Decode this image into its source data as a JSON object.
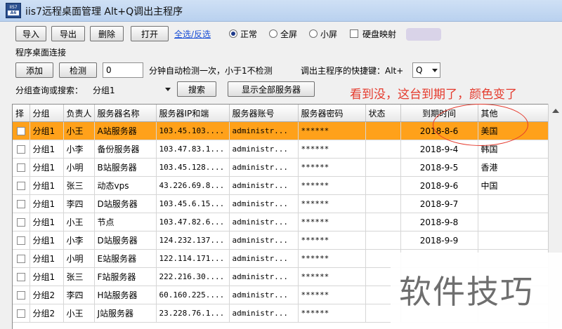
{
  "window": {
    "title": "iis7远程桌面管理 Alt+Q调出主程序",
    "icon_label_top": "IIS7",
    "icon_label_bottom": "A6"
  },
  "toolbar": {
    "import_label": "导入",
    "export_label": "导出",
    "delete_label": "删除",
    "open_label": "打开",
    "select_all_link": "全选/反选",
    "radio_normal": "正常",
    "radio_fullscreen": "全屏",
    "radio_small": "小屏",
    "disk_map_label": "硬盘映射"
  },
  "section": {
    "title": "程序桌面连接",
    "add_label": "添加",
    "detect_label": "检测",
    "interval_value": "0",
    "interval_text": "分钟自动检测一次，小于1不检测",
    "hotkey_text": "调出主程序的快捷键：Alt+",
    "hotkey_value": "Q"
  },
  "search": {
    "label": "分组查询或搜索：",
    "group_value": "分组1",
    "search_label": "搜索",
    "show_all_label": "显示全部服务器"
  },
  "annotation": "看到没，这台到期了，颜色变了",
  "table": {
    "columns": [
      "择",
      "分组",
      "负责人",
      "服务器名称",
      "服务器IP和端",
      "服务器账号",
      "服务器密码",
      "状态",
      "到期时间",
      "其他"
    ],
    "rows": [
      {
        "group": "分组1",
        "owner": "小王",
        "name": "A站服务器",
        "ip": "103.45.103....",
        "account": "administr...",
        "password": "******",
        "status": "",
        "expire": "2018-8-6",
        "other": "美国",
        "expired": true
      },
      {
        "group": "分组1",
        "owner": "小李",
        "name": "备份服务器",
        "ip": "103.47.83.1...",
        "account": "administr...",
        "password": "******",
        "status": "",
        "expire": "2018-9-4",
        "other": "韩国"
      },
      {
        "group": "分组1",
        "owner": "小明",
        "name": "B站服务器",
        "ip": "103.45.128....",
        "account": "administr...",
        "password": "******",
        "status": "",
        "expire": "2018-9-5",
        "other": "香港"
      },
      {
        "group": "分组1",
        "owner": "张三",
        "name": "动态vps",
        "ip": "43.226.69.8...",
        "account": "administr...",
        "password": "******",
        "status": "",
        "expire": "2018-9-6",
        "other": "中国"
      },
      {
        "group": "分组1",
        "owner": "李四",
        "name": "D站服务器",
        "ip": "103.45.6.15...",
        "account": "administr...",
        "password": "******",
        "status": "",
        "expire": "2018-9-7",
        "other": ""
      },
      {
        "group": "分组1",
        "owner": "小王",
        "name": "节点",
        "ip": "103.47.82.6...",
        "account": "administr...",
        "password": "******",
        "status": "",
        "expire": "2018-9-8",
        "other": ""
      },
      {
        "group": "分组1",
        "owner": "小李",
        "name": "D站服务器",
        "ip": "124.232.137...",
        "account": "administr...",
        "password": "******",
        "status": "",
        "expire": "2018-9-9",
        "other": ""
      },
      {
        "group": "分组1",
        "owner": "小明",
        "name": "E站服务器",
        "ip": "122.114.171...",
        "account": "administr...",
        "password": "******",
        "status": "",
        "expire": "",
        "other": ""
      },
      {
        "group": "分组1",
        "owner": "张三",
        "name": "F站服务器",
        "ip": "222.216.30....",
        "account": "administr...",
        "password": "******",
        "status": "",
        "expire": "",
        "other": ""
      },
      {
        "group": "分组2",
        "owner": "李四",
        "name": "H站服务器",
        "ip": "60.160.225....",
        "account": "administr...",
        "password": "******",
        "status": "",
        "expire": "",
        "other": ""
      },
      {
        "group": "分组2",
        "owner": "小王",
        "name": "J站服务器",
        "ip": "23.228.76.1...",
        "account": "administr...",
        "password": "******",
        "status": "",
        "expire": "",
        "other": ""
      }
    ]
  },
  "watermark": "软件技巧",
  "colors": {
    "expired_row": "#ffa11a",
    "annotation": "#e53a2d",
    "link": "#1a4fd6"
  }
}
